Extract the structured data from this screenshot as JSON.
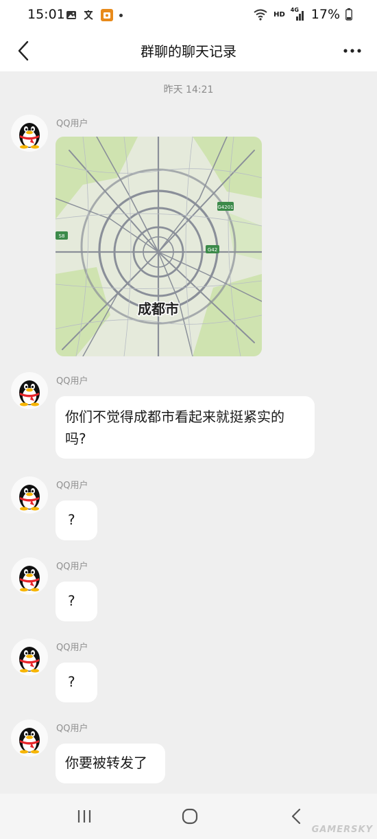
{
  "status": {
    "time": "15:01",
    "network": "HD",
    "signal": "4G",
    "battery": "17%"
  },
  "header": {
    "title": "群聊的聊天记录"
  },
  "timestamp": "昨天 14:21",
  "map": {
    "city_label": "成都市",
    "road_badges": [
      "G4201",
      "S8",
      "G42"
    ]
  },
  "messages": [
    {
      "sender": "QQ用户",
      "type": "image"
    },
    {
      "sender": "QQ用户",
      "text": "你们不觉得成都市看起来就挺紧实的吗?"
    },
    {
      "sender": "QQ用户",
      "text": "?"
    },
    {
      "sender": "QQ用户",
      "text": "?"
    },
    {
      "sender": "QQ用户",
      "text": "?"
    },
    {
      "sender": "QQ用户",
      "text": "你要被转发了"
    }
  ],
  "watermark": "GAMERSKY",
  "icons": {
    "back": "chevron-left-icon",
    "more": "more-dots-icon",
    "recent_apps": "recent-apps-icon",
    "home": "home-icon",
    "nav_back": "back-icon"
  }
}
